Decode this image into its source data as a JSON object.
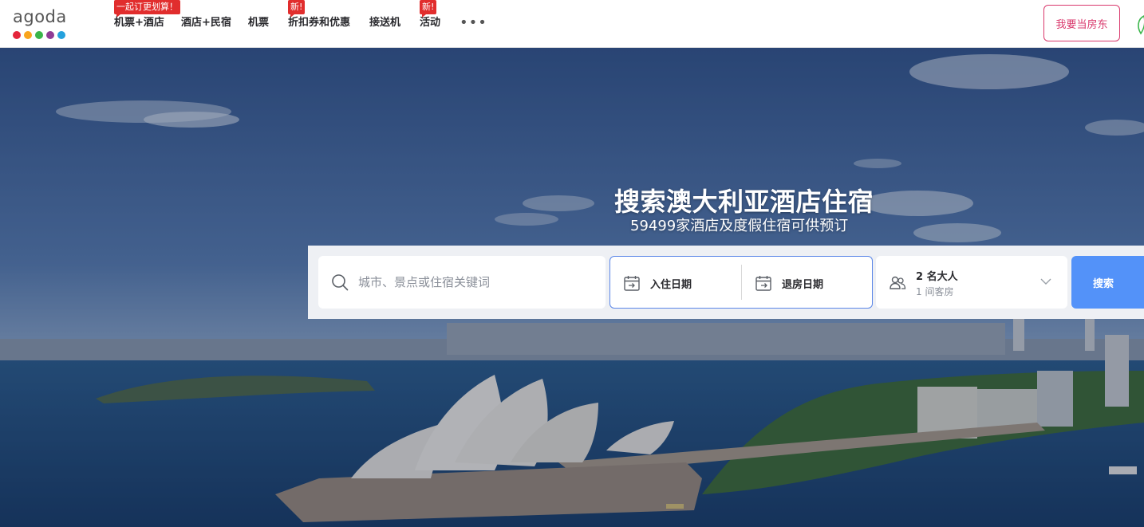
{
  "brand": {
    "logo_text": "agoda",
    "dot_colors": [
      "#e4253b",
      "#f9a41d",
      "#3ab54a",
      "#8f3b95",
      "#24a1dd"
    ]
  },
  "nav": {
    "items": [
      {
        "label": "机票+酒店",
        "badge": "一起订更划算！"
      },
      {
        "label": "酒店+民宿",
        "badge": ""
      },
      {
        "label": "机票",
        "badge": ""
      },
      {
        "label": "折扣券和优惠",
        "badge": "新!"
      },
      {
        "label": "接送机",
        "badge": ""
      },
      {
        "label": "活动",
        "badge": "新!"
      }
    ],
    "more": "•••",
    "host_button": "我要当房东"
  },
  "hero": {
    "title": "搜索澳大利亚酒店住宿",
    "subtitle": "59499家酒店及度假住宿可供预订"
  },
  "search": {
    "destination_placeholder": "城市、景点或住宿关键词",
    "checkin_label": "入住日期",
    "checkout_label": "退房日期",
    "guests_main": "2 名大人",
    "guests_sub": "1 间客房",
    "search_button": "搜索"
  },
  "colors": {
    "accent_blue": "#5392f9",
    "host_pink": "#d9386c",
    "badge_red": "#e12d2d"
  }
}
